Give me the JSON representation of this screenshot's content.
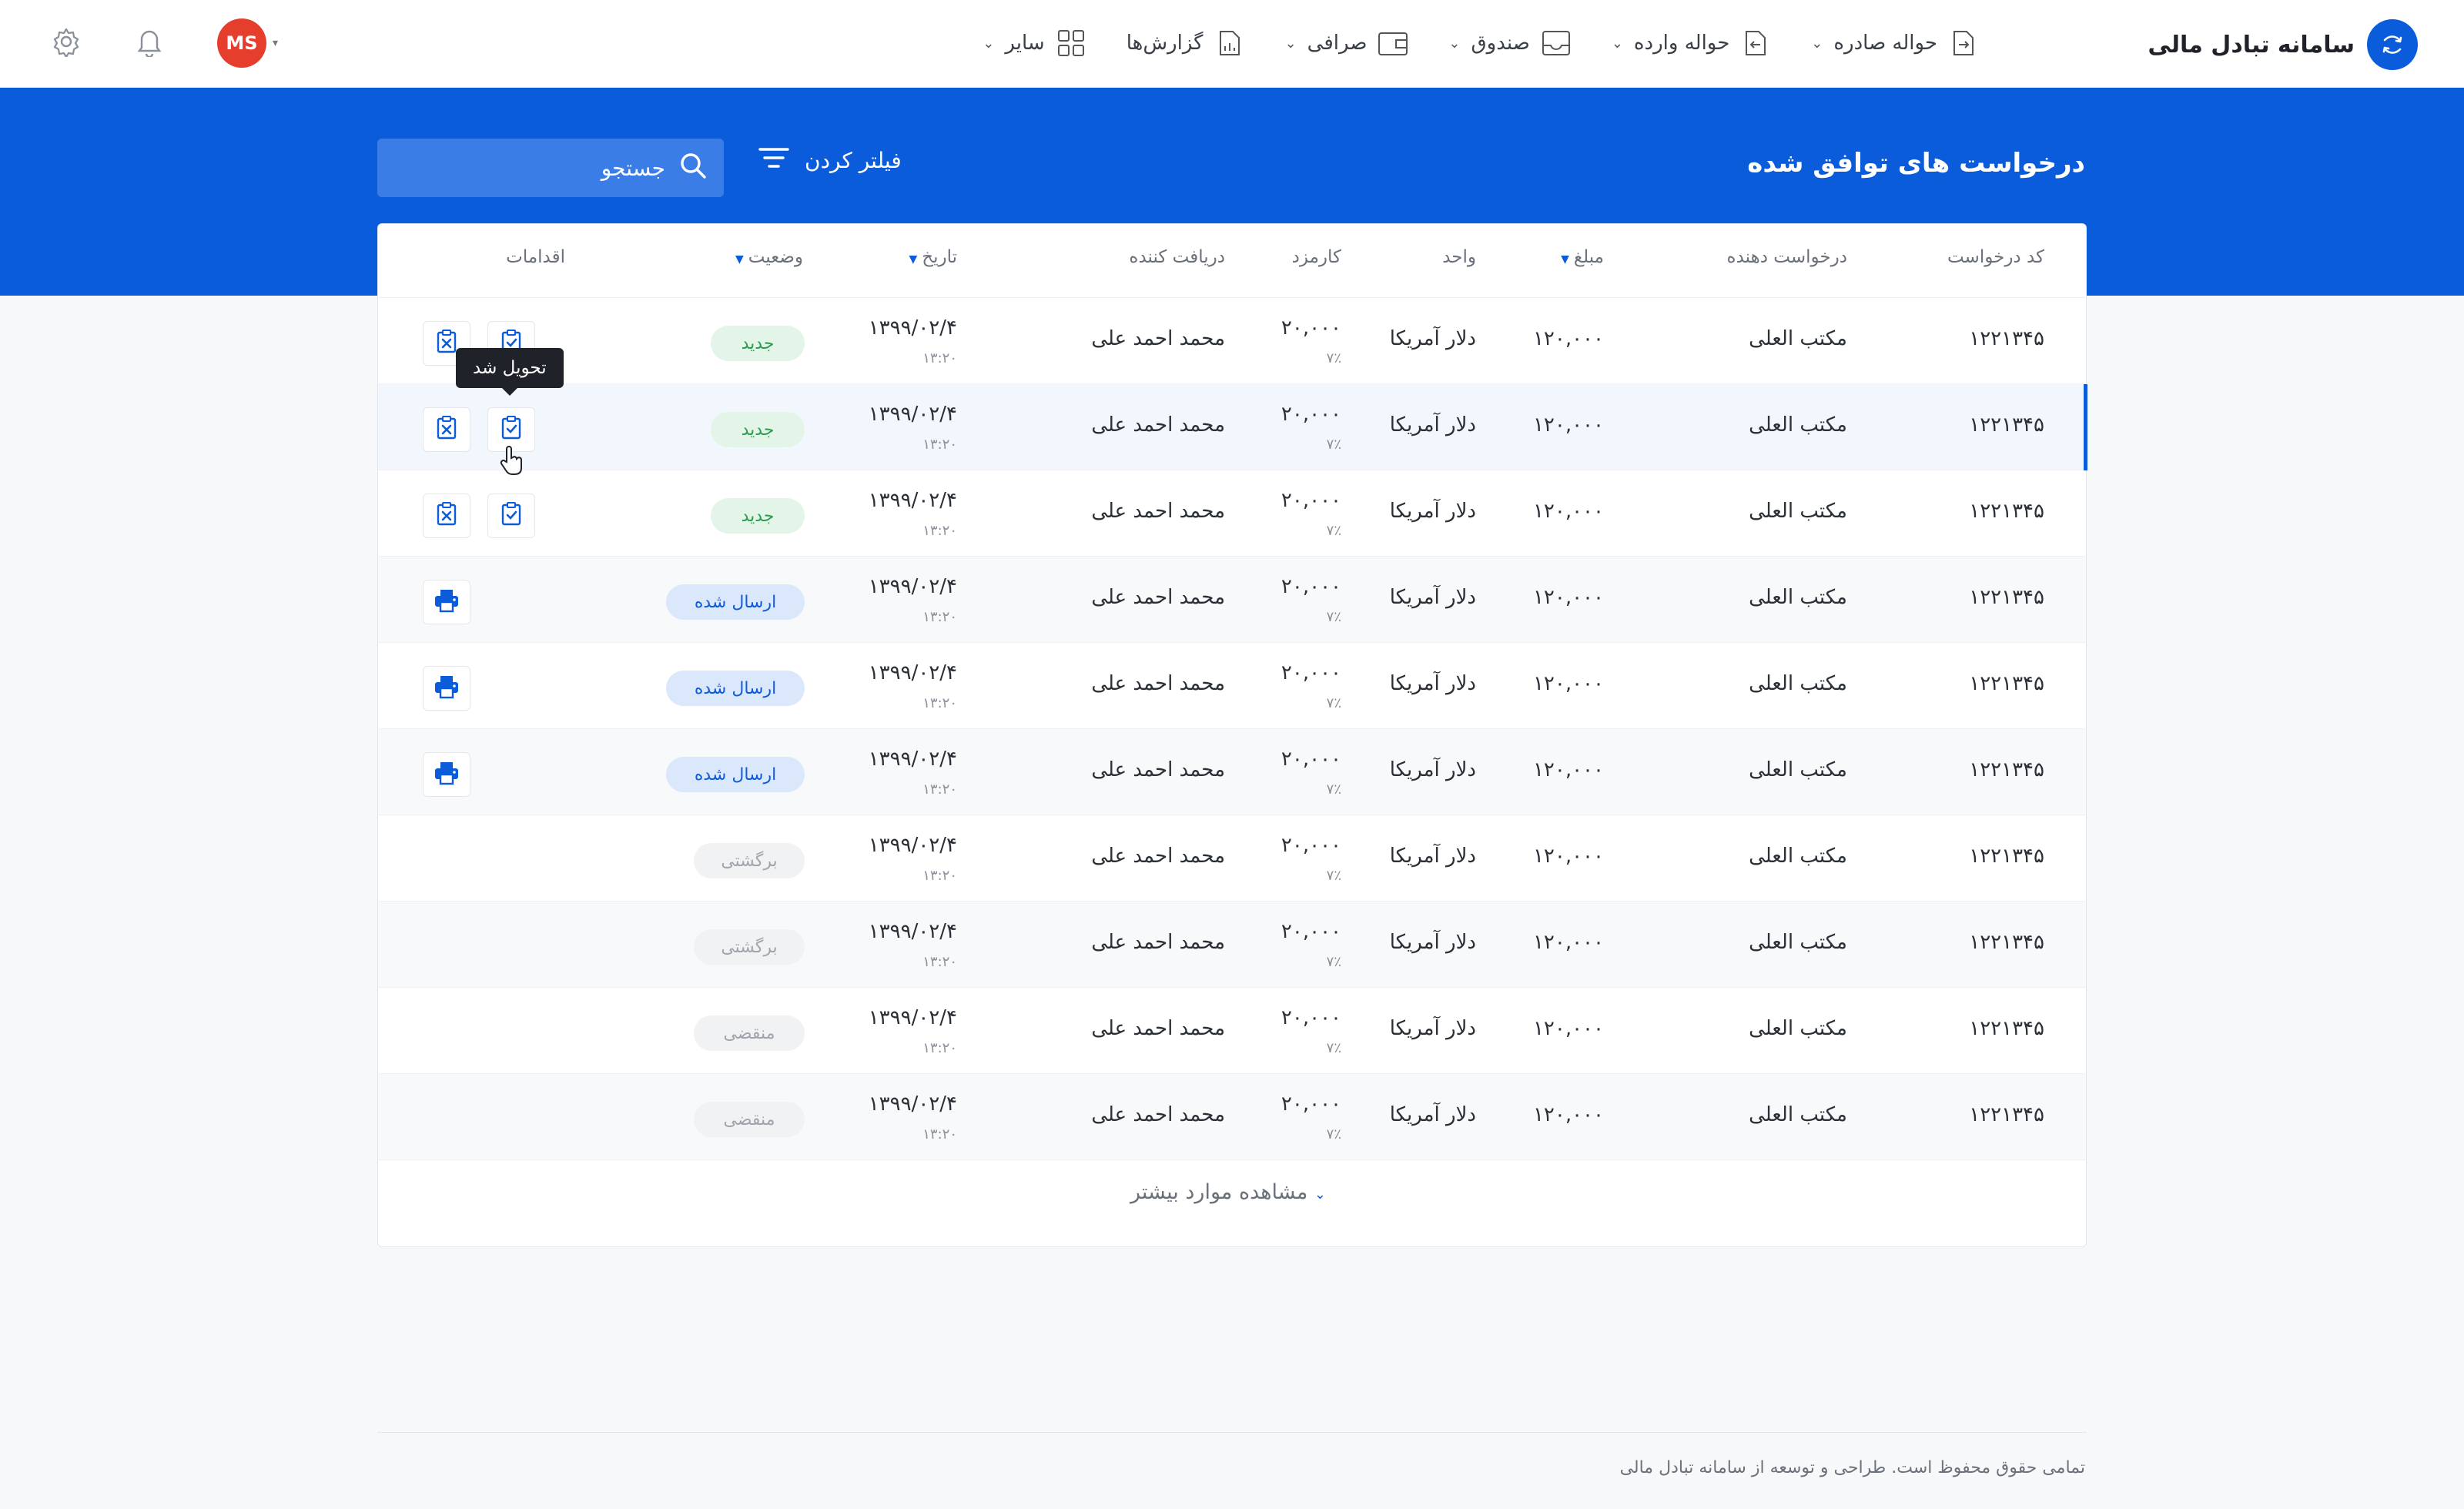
{
  "brand": {
    "title": "سامانه تبادل مالی"
  },
  "nav": [
    {
      "label": "حواله صادره",
      "icon": "outgoing-transfer-icon"
    },
    {
      "label": "حواله وارده",
      "icon": "incoming-transfer-icon"
    },
    {
      "label": "صندوق",
      "icon": "inbox-icon"
    },
    {
      "label": "صرافی",
      "icon": "wallet-icon"
    },
    {
      "label": "گزارش‌ها",
      "icon": "report-icon"
    },
    {
      "label": "سایر",
      "icon": "grid-icon"
    }
  ],
  "user": {
    "initials": "MS",
    "avatar_color": "#e63e2c"
  },
  "page": {
    "title": "درخواست های توافق شده"
  },
  "filter": {
    "label": "فیلتر کردن"
  },
  "search": {
    "placeholder": "جستجو"
  },
  "table": {
    "headers": {
      "code": "کد درخواست",
      "requester": "درخواست دهنده",
      "amount": "مبلغ",
      "unit": "واحد",
      "fee": "کارمزد",
      "receiver": "دریافت کننده",
      "date": "تاریخ",
      "status": "وضعیت",
      "actions": "اقدامات"
    },
    "rows": [
      {
        "code": "۱۲۲۱۳۴۵",
        "requester": "مکتب العلی",
        "amount": "۱۲۰,۰۰۰",
        "unit": "دلار آمریکا",
        "fee": "۲۰,۰۰۰",
        "fee_pct": "۷٪",
        "receiver": "محمد احمد علی",
        "date": "۱۳۹۹/۰۲/۴",
        "time": "۱۳:۲۰",
        "status": "جدید",
        "status_type": "new",
        "actions": "deliver-cancel"
      },
      {
        "code": "۱۲۲۱۳۴۵",
        "requester": "مکتب العلی",
        "amount": "۱۲۰,۰۰۰",
        "unit": "دلار آمریکا",
        "fee": "۲۰,۰۰۰",
        "fee_pct": "۷٪",
        "receiver": "محمد احمد علی",
        "date": "۱۳۹۹/۰۲/۴",
        "time": "۱۳:۲۰",
        "status": "جدید",
        "status_type": "new",
        "actions": "deliver-cancel"
      },
      {
        "code": "۱۲۲۱۳۴۵",
        "requester": "مکتب العلی",
        "amount": "۱۲۰,۰۰۰",
        "unit": "دلار آمریکا",
        "fee": "۲۰,۰۰۰",
        "fee_pct": "۷٪",
        "receiver": "محمد احمد علی",
        "date": "۱۳۹۹/۰۲/۴",
        "time": "۱۳:۲۰",
        "status": "جدید",
        "status_type": "new",
        "actions": "deliver-cancel"
      },
      {
        "code": "۱۲۲۱۳۴۵",
        "requester": "مکتب العلی",
        "amount": "۱۲۰,۰۰۰",
        "unit": "دلار آمریکا",
        "fee": "۲۰,۰۰۰",
        "fee_pct": "۷٪",
        "receiver": "محمد احمد علی",
        "date": "۱۳۹۹/۰۲/۴",
        "time": "۱۳:۲۰",
        "status": "ارسال شده",
        "status_type": "sent",
        "actions": "print"
      },
      {
        "code": "۱۲۲۱۳۴۵",
        "requester": "مکتب العلی",
        "amount": "۱۲۰,۰۰۰",
        "unit": "دلار آمریکا",
        "fee": "۲۰,۰۰۰",
        "fee_pct": "۷٪",
        "receiver": "محمد احمد علی",
        "date": "۱۳۹۹/۰۲/۴",
        "time": "۱۳:۲۰",
        "status": "ارسال شده",
        "status_type": "sent",
        "actions": "print"
      },
      {
        "code": "۱۲۲۱۳۴۵",
        "requester": "مکتب العلی",
        "amount": "۱۲۰,۰۰۰",
        "unit": "دلار آمریکا",
        "fee": "۲۰,۰۰۰",
        "fee_pct": "۷٪",
        "receiver": "محمد احمد علی",
        "date": "۱۳۹۹/۰۲/۴",
        "time": "۱۳:۲۰",
        "status": "ارسال شده",
        "status_type": "sent",
        "actions": "print"
      },
      {
        "code": "۱۲۲۱۳۴۵",
        "requester": "مکتب العلی",
        "amount": "۱۲۰,۰۰۰",
        "unit": "دلار آمریکا",
        "fee": "۲۰,۰۰۰",
        "fee_pct": "۷٪",
        "receiver": "محمد احمد علی",
        "date": "۱۳۹۹/۰۲/۴",
        "time": "۱۳:۲۰",
        "status": "برگشتی",
        "status_type": "ret",
        "actions": "none"
      },
      {
        "code": "۱۲۲۱۳۴۵",
        "requester": "مکتب العلی",
        "amount": "۱۲۰,۰۰۰",
        "unit": "دلار آمریکا",
        "fee": "۲۰,۰۰۰",
        "fee_pct": "۷٪",
        "receiver": "محمد احمد علی",
        "date": "۱۳۹۹/۰۲/۴",
        "time": "۱۳:۲۰",
        "status": "برگشتی",
        "status_type": "ret",
        "actions": "none"
      },
      {
        "code": "۱۲۲۱۳۴۵",
        "requester": "مکتب العلی",
        "amount": "۱۲۰,۰۰۰",
        "unit": "دلار آمریکا",
        "fee": "۲۰,۰۰۰",
        "fee_pct": "۷٪",
        "receiver": "محمد احمد علی",
        "date": "۱۳۹۹/۰۲/۴",
        "time": "۱۳:۲۰",
        "status": "منقضی",
        "status_type": "exp",
        "actions": "none"
      },
      {
        "code": "۱۲۲۱۳۴۵",
        "requester": "مکتب العلی",
        "amount": "۱۲۰,۰۰۰",
        "unit": "دلار آمریکا",
        "fee": "۲۰,۰۰۰",
        "fee_pct": "۷٪",
        "receiver": "محمد احمد علی",
        "date": "۱۳۹۹/۰۲/۴",
        "time": "۱۳:۲۰",
        "status": "منقضی",
        "status_type": "exp",
        "actions": "none"
      }
    ]
  },
  "tooltip": {
    "label": "تحویل شد"
  },
  "load_more": {
    "label": "مشاهده موارد بیشتر"
  },
  "footer": {
    "text": "تمامی حقوق محفوظ است. طراحی و توسعه از سامانه تبادل مالی"
  },
  "colors": {
    "primary": "#0b5cdb",
    "new": "#2a9d4b",
    "sent": "#0b5cdb",
    "muted": "#a0a5ad"
  }
}
